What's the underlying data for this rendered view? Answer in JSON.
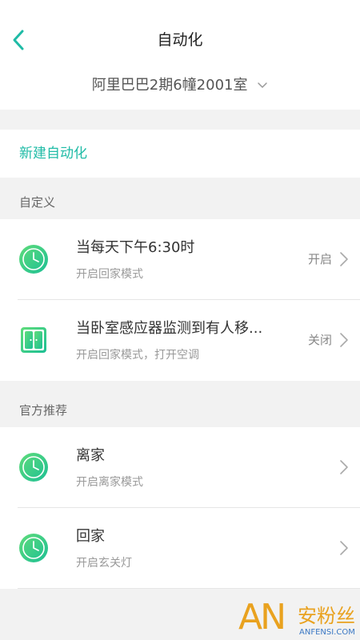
{
  "header": {
    "title": "自动化",
    "back_icon": "chevron-left-icon"
  },
  "location": {
    "name": "阿里巴巴2期6幢2001室",
    "dropdown_icon": "chevron-down-icon"
  },
  "new_automation": {
    "label": "新建自动化"
  },
  "sections": [
    {
      "title": "自定义",
      "items": [
        {
          "icon": "clock-icon",
          "title": "当每天下午6:30时",
          "subtitle": "开启回家模式",
          "status": "开启"
        },
        {
          "icon": "sensor-icon",
          "title": "当卧室感应器监测到有人移...",
          "subtitle": "开启回家模式，打开空调",
          "status": "关闭"
        }
      ]
    },
    {
      "title": "官方推荐",
      "items": [
        {
          "icon": "clock-icon",
          "title": "离家",
          "subtitle": "开启离家模式"
        },
        {
          "icon": "clock-icon",
          "title": "回家",
          "subtitle": "开启玄关灯"
        }
      ]
    }
  ],
  "colors": {
    "accent": "#1fbba6",
    "icon_green_light": "#5fdc7a",
    "icon_green_dark": "#1cbf94",
    "background": "#f2f2f2"
  },
  "watermark": {
    "mark": "AN",
    "name": "安粉丝",
    "site": "ANFENSI.COM"
  }
}
